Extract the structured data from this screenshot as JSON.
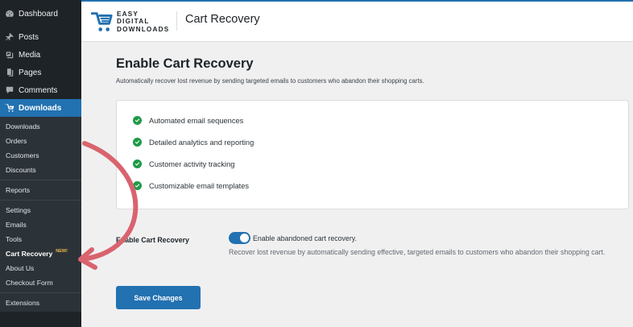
{
  "sidebar": {
    "top_items": {
      "dashboard": "Dashboard",
      "posts": "Posts",
      "media": "Media",
      "pages": "Pages",
      "comments": "Comments",
      "downloads": "Downloads"
    },
    "submenu": {
      "downloads": "Downloads",
      "orders": "Orders",
      "customers": "Customers",
      "discounts": "Discounts",
      "reports": "Reports",
      "settings": "Settings",
      "emails": "Emails",
      "tools": "Tools",
      "cart_recovery": "Cart Recovery",
      "cart_recovery_badge": "NEW!",
      "about_us": "About Us",
      "checkout_form": "Checkout Form",
      "extensions": "Extensions"
    }
  },
  "header": {
    "logo_line1": "EASY",
    "logo_line2": "DIGITAL",
    "logo_line3": "DOWNLOADS",
    "title": "Cart Recovery"
  },
  "main": {
    "title": "Enable Cart Recovery",
    "description": "Automatically recover lost revenue by sending targeted emails to customers who abandon their shopping carts.",
    "features": [
      "Automated email sequences",
      "Detailed analytics and reporting",
      "Customer activity tracking",
      "Customizable email templates"
    ],
    "setting": {
      "label": "Enable Cart Recovery",
      "toggle_label": "Enable abandoned cart recovery.",
      "toggle_on": true,
      "help": "Recover lost revenue by automatically sending effective, targeted emails to customers who abandon their shopping cart."
    },
    "save_label": "Save Changes"
  },
  "colors": {
    "accent": "#2271b1",
    "sidebar_bg": "#1d2327",
    "check_green": "#1e9a46",
    "arrow": "#d9636e"
  }
}
